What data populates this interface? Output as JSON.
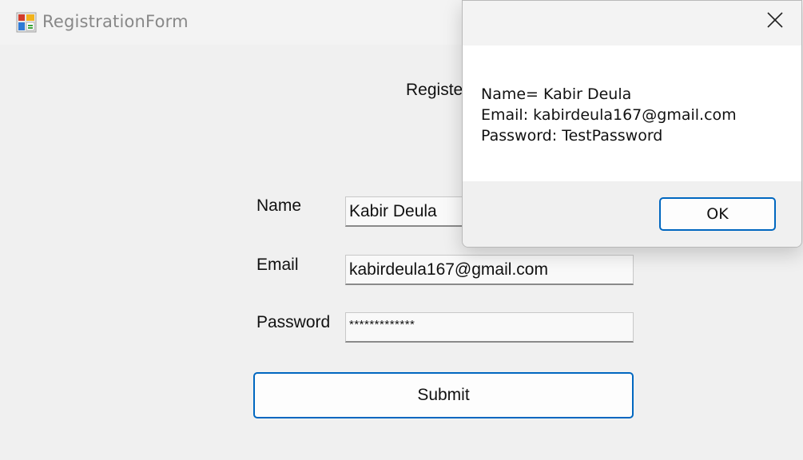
{
  "window": {
    "title": "RegistrationForm",
    "icon": "windows-form-icon"
  },
  "form": {
    "heading": "Registe",
    "name_label": "Name",
    "name_value": "Kabir Deula",
    "email_label": "Email",
    "email_value": "kabirdeula167@gmail.com",
    "password_label": "Password",
    "password_value": "*************",
    "submit_label": "Submit"
  },
  "message_box": {
    "close_icon": "close-icon",
    "lines": [
      "Name= Kabir Deula",
      "Email: kabirdeula167@gmail.com",
      "Password: TestPassword"
    ],
    "ok_label": "OK"
  },
  "colors": {
    "accent_border": "#0067c0",
    "window_bg": "#f0f0f0",
    "title_text": "#888888"
  }
}
